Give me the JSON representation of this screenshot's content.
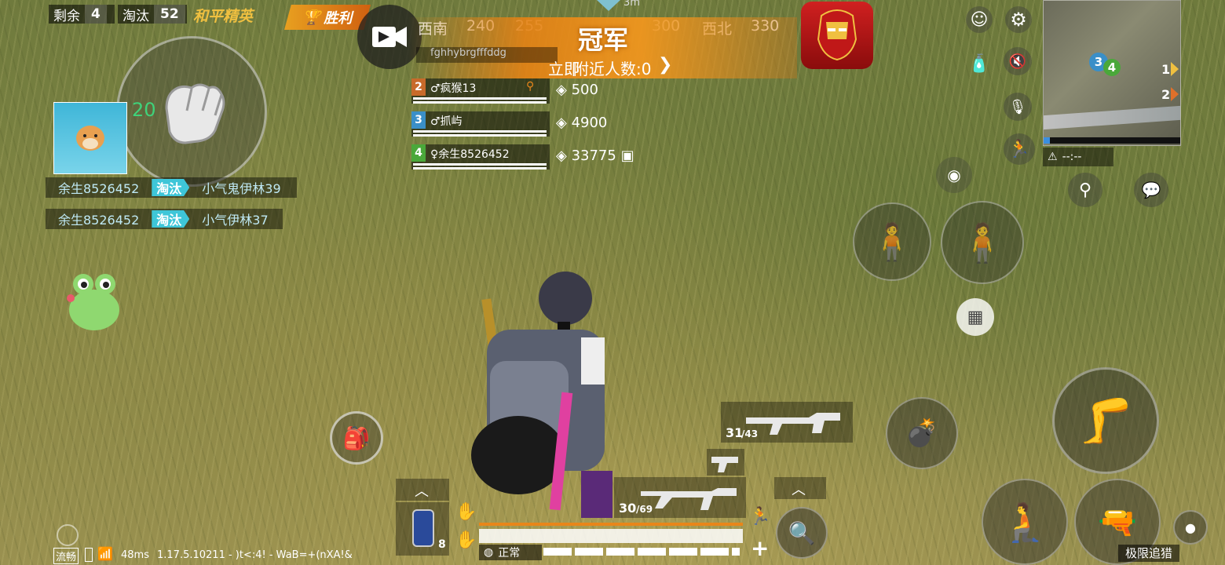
{
  "hud": {
    "remaining_label": "剩余",
    "remaining_value": "4",
    "eliminated_label": "淘汰",
    "eliminated_value": "52",
    "rank_title": "和平精英",
    "victory_badge": "胜利"
  },
  "compass": {
    "marks": [
      "西南",
      "240",
      "255",
      "300",
      "西北",
      "330"
    ],
    "top_marker": "3m"
  },
  "banner": {
    "title": "冠军",
    "nearby_text": "附近人数:0",
    "prefix": "立即",
    "player_top": "fghhybrgfffddg"
  },
  "team": [
    {
      "no": "2",
      "name": "♂疯猴13",
      "color": "#c86a2a",
      "value": "500"
    },
    {
      "no": "3",
      "name": "♂抓屿",
      "color": "#3a8fc8",
      "value": "4900"
    },
    {
      "no": "4",
      "name": "♀余生8526452",
      "color": "#4aa83a",
      "value": "33775"
    }
  ],
  "self": {
    "kill_count": "20"
  },
  "killfeed": [
    {
      "killer": "余生8526452",
      "action": "淘汰",
      "victim": "小气鬼伊林39"
    },
    {
      "killer": "余生8526452",
      "action": "淘汰",
      "victim": "小气伊林37"
    }
  ],
  "weapons": {
    "primary_ammo": "31",
    "primary_reserve": "43",
    "secondary_ammo": "30",
    "secondary_reserve": "69"
  },
  "items": {
    "consumable_count": "8"
  },
  "minimap": {
    "teammate_a": "3",
    "teammate_b": "4",
    "marker_1": "1",
    "marker_2": "2",
    "timer": "--:--"
  },
  "status": {
    "network": "流畅",
    "ping": "48ms",
    "version": "1.17.5.10211 - )t<:4! - WaB=+(nXA!&",
    "mode_label": "正常",
    "bottom_right_label": "极限追猎"
  },
  "colors": {
    "banner": "#e8861a",
    "feed_tag": "#3ec6d8",
    "kill_count": "#3fd27a"
  }
}
